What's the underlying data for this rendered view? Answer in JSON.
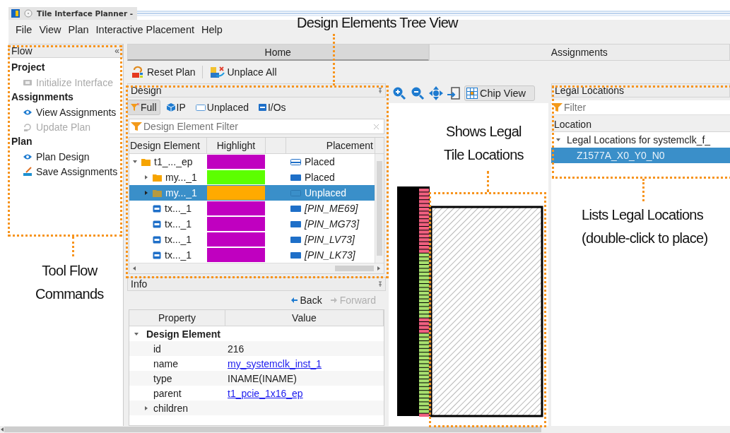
{
  "window": {
    "title": "Tile Interface Planner -"
  },
  "menu": [
    "File",
    "View",
    "Plan",
    "Interactive Placement",
    "Help"
  ],
  "flow": {
    "title": "Flow",
    "collapse_glyph": "«",
    "sections": [
      {
        "heading": "Project",
        "items": [
          {
            "label": "Initialize Interface",
            "kind": "init",
            "disabled": true
          }
        ]
      },
      {
        "heading": "Assignments",
        "items": [
          {
            "label": "View Assignments",
            "kind": "view",
            "disabled": false
          },
          {
            "label": "Update Plan",
            "kind": "update",
            "disabled": true
          }
        ]
      },
      {
        "heading": "Plan",
        "items": [
          {
            "label": "Plan Design",
            "kind": "view",
            "disabled": false
          },
          {
            "label": "Save Assignments",
            "kind": "save",
            "disabled": false
          }
        ]
      }
    ]
  },
  "tabs": [
    {
      "label": "Home",
      "selected": true
    },
    {
      "label": "Assignments",
      "selected": false
    }
  ],
  "toolbar": [
    {
      "label": "Reset Plan",
      "kind": "reset"
    },
    {
      "label": "Unplace All",
      "kind": "unplace"
    }
  ],
  "design": {
    "title": "Design",
    "filters": [
      {
        "label": "Full",
        "kind": "full",
        "selected": true
      },
      {
        "label": "IP",
        "kind": "ip",
        "selected": false
      },
      {
        "label": "Unplaced",
        "kind": "unplaced",
        "selected": false
      },
      {
        "label": "I/Os",
        "kind": "io",
        "selected": false
      }
    ],
    "filter_placeholder": "Design Element Filter",
    "columns": [
      "Design Element",
      "Highlight",
      "Placement"
    ],
    "tree": [
      {
        "name": "t1_..._ep",
        "kind": "folder",
        "expanded": true,
        "selected": false,
        "color": "#c000c0",
        "placement": {
          "text": "Placed",
          "kind": "partial"
        },
        "children": [
          {
            "name": "my..._1",
            "kind": "folder",
            "expanded": false,
            "selected": false,
            "color": "#5cff00",
            "placement": {
              "text": "Placed",
              "kind": "placed"
            }
          },
          {
            "name": "my..._1",
            "kind": "folder",
            "expanded": false,
            "selected": true,
            "color": "#ffaa00",
            "placement": {
              "text": "Unplaced",
              "kind": "unplaced"
            }
          },
          {
            "name": "tx..._1",
            "kind": "io",
            "selected": false,
            "color": "#c000c0",
            "placement": {
              "text": "[PIN_ME69]",
              "kind": "pin"
            }
          },
          {
            "name": "tx..._1",
            "kind": "io",
            "selected": false,
            "color": "#c000c0",
            "placement": {
              "text": "[PIN_MG73]",
              "kind": "pin"
            }
          },
          {
            "name": "tx..._1",
            "kind": "io",
            "selected": false,
            "color": "#c000c0",
            "placement": {
              "text": "[PIN_LV73]",
              "kind": "pin"
            }
          },
          {
            "name": "tx..._1",
            "kind": "io",
            "selected": false,
            "color": "#c000c0",
            "placement": {
              "text": "[PIN_LK73]",
              "kind": "pin"
            }
          }
        ]
      }
    ]
  },
  "info": {
    "title": "Info",
    "nav": [
      {
        "label": "Back",
        "kind": "back",
        "disabled": false
      },
      {
        "label": "Forward",
        "kind": "forward",
        "disabled": true
      }
    ],
    "columns": [
      "Property",
      "Value"
    ],
    "groups": [
      {
        "label": "Design Element",
        "expanded": true,
        "rows": [
          {
            "property": "id",
            "value": "216",
            "kind": "text"
          },
          {
            "property": "name",
            "value": "my_systemclk_inst_1",
            "kind": "link"
          },
          {
            "property": "type",
            "value": "INAME(INAME)",
            "kind": "text"
          },
          {
            "property": "parent",
            "value": "t1_pcie_1x16_ep",
            "kind": "link"
          },
          {
            "property": "children",
            "kind": "group",
            "expanded": false
          }
        ]
      }
    ]
  },
  "chip_view": {
    "button": "Chip View"
  },
  "legal": {
    "title": "Legal Locations",
    "filter_placeholder": "Filter",
    "column": "Location",
    "tree": [
      {
        "label": "Legal Locations for systemclk_f_",
        "expanded": true,
        "selected": false,
        "children": [
          {
            "label": "Z1577A_X0_Y0_N0",
            "selected": true
          }
        ]
      }
    ]
  },
  "annotations": [
    {
      "lines": [
        "Design Elements Tree View"
      ]
    },
    {
      "lines": [
        "Tool Flow",
        "Commands"
      ]
    },
    {
      "lines": [
        "Shows Legal",
        "Tile Locations"
      ]
    },
    {
      "lines": [
        "Lists Legal Locations",
        "(double-click to place)"
      ]
    }
  ]
}
